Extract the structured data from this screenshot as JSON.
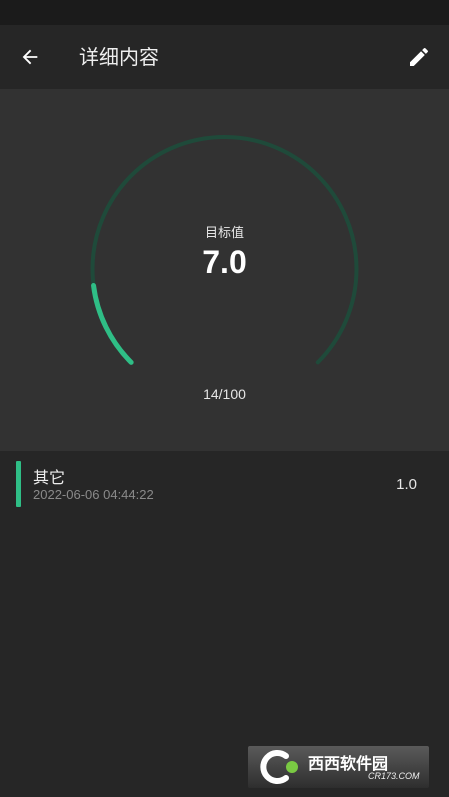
{
  "appbar": {
    "title": "详细内容",
    "back_icon": "arrow-left-icon",
    "edit_icon": "pencil-icon"
  },
  "gauge": {
    "label": "目标值",
    "value": "7.0",
    "progress_text": "14/100",
    "progress_fraction": 0.14,
    "accent_color": "#2fbe86",
    "track_color": "#1f4a3a"
  },
  "records": [
    {
      "name": "其它",
      "time": "2022-06-06 04:44:22",
      "value": "1.0"
    }
  ],
  "watermark": {
    "logo_text": "西西软件园",
    "domain": "CR173.COM"
  }
}
